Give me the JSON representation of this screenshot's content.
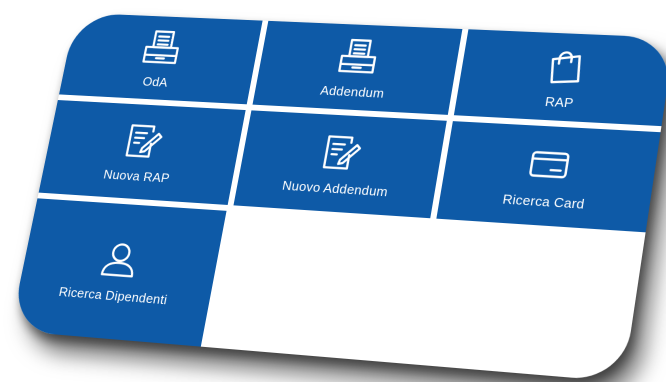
{
  "tiles": [
    {
      "label": "OdA",
      "icon": "tray-document-icon"
    },
    {
      "label": "Addendum",
      "icon": "tray-document-icon"
    },
    {
      "label": "RAP",
      "icon": "shopping-bag-icon"
    },
    {
      "label": "Nuova RAP",
      "icon": "edit-document-icon"
    },
    {
      "label": "Nuovo Addendum",
      "icon": "edit-document-icon"
    },
    {
      "label": "Ricerca Card",
      "icon": "credit-card-icon"
    },
    {
      "label": "Ricerca Dipendenti",
      "icon": "user-icon"
    }
  ],
  "colors": {
    "tile_background": "#0e5aa7",
    "tile_text": "#ffffff",
    "card_background": "#ffffff"
  }
}
